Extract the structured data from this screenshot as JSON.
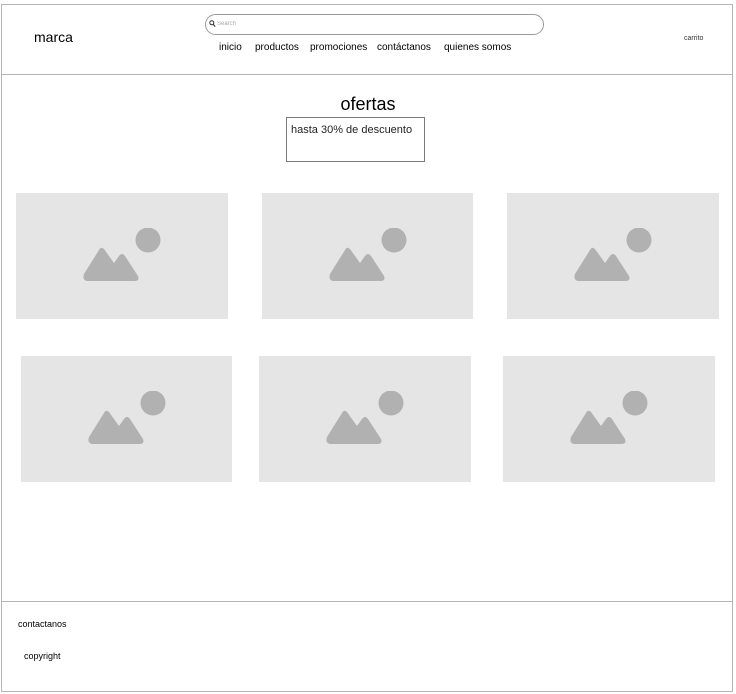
{
  "header": {
    "brand": "marca",
    "search": {
      "placeholder": "Search",
      "icon": "search-icon"
    },
    "nav": [
      "inicio",
      "productos",
      "promociones",
      "contáctanos",
      "quienes somos"
    ],
    "cart": "carrito"
  },
  "offers": {
    "title": "ofertas",
    "discount": "hasta 30% de descuento"
  },
  "products": {
    "count": 6,
    "icon": "image-placeholder-icon",
    "colors": {
      "tile": "#e5e5e5",
      "icon": "#b1b1b1"
    }
  },
  "footer": {
    "contact": "contactanos",
    "copyright": "copyright"
  }
}
